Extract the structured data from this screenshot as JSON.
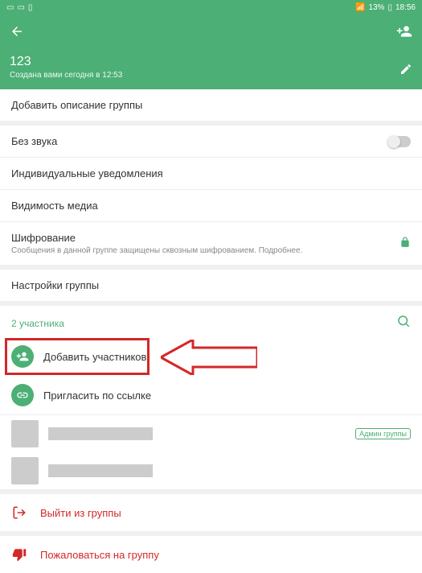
{
  "status": {
    "battery": "13%",
    "time": "18:56"
  },
  "header": {
    "title": "123",
    "subtitle": "Создана вами сегодня в 12:53"
  },
  "rows": {
    "add_description": "Добавить описание группы",
    "mute": "Без звука",
    "individual_notifications": "Индивидуальные уведомления",
    "media_visibility": "Видимость медиа",
    "encryption_title": "Шифрование",
    "encryption_sub": "Сообщения в данной группе защищены сквозным шифрованием. Подробнее.",
    "group_settings": "Настройки группы"
  },
  "participants": {
    "count": "2 участника",
    "add": "Добавить участников",
    "invite": "Пригласить по ссылке",
    "admin_badge": "Админ группы"
  },
  "danger": {
    "leave": "Выйти из группы",
    "report": "Пожаловаться на группу"
  }
}
